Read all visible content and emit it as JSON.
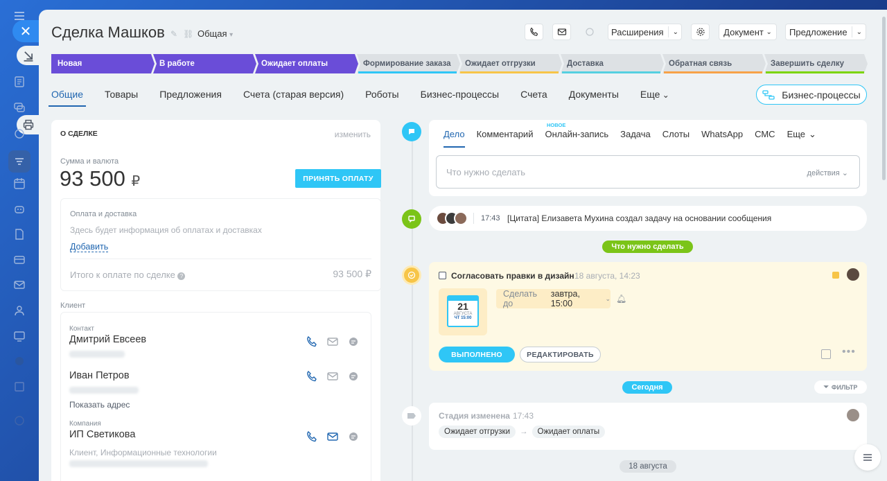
{
  "deal": {
    "title": "Сделка Машков",
    "category": "Общая",
    "category_arrow": "▾"
  },
  "toolbar": {
    "extensions": "Расширения",
    "document": "Документ",
    "proposal": "Предложение"
  },
  "stages": [
    {
      "label": "Новая",
      "bg": "#6a4dd8",
      "fg": "#ffffff"
    },
    {
      "label": "В работе",
      "bg": "#6a4dd8",
      "fg": "#ffffff"
    },
    {
      "label": "Ожидает оплаты",
      "bg": "#6a4dd8",
      "fg": "#ffffff"
    },
    {
      "label": "Формирование заказа",
      "bg": "#dde1e4",
      "fg": "#535c69",
      "accent": "#2fc6f6"
    },
    {
      "label": "Ожидает отгрузки",
      "bg": "#dde1e4",
      "fg": "#535c69",
      "accent": "#f7c548"
    },
    {
      "label": "Доставка",
      "bg": "#dde1e4",
      "fg": "#535c69",
      "accent": "#55d0e0"
    },
    {
      "label": "Обратная связь",
      "bg": "#dde1e4",
      "fg": "#535c69",
      "accent": "#f7a248"
    },
    {
      "label": "Завершить сделку",
      "bg": "#dde1e4",
      "fg": "#535c69",
      "accent": "#7bd500"
    }
  ],
  "tabs": [
    {
      "label": "Общие",
      "active": true
    },
    {
      "label": "Товары"
    },
    {
      "label": "Предложения"
    },
    {
      "label": "Счета (старая версия)"
    },
    {
      "label": "Роботы"
    },
    {
      "label": "Бизнес-процессы"
    },
    {
      "label": "Счета"
    },
    {
      "label": "Документы"
    },
    {
      "label": "Еще"
    }
  ],
  "bp_button": "Бизнес-процессы",
  "about": {
    "header": "О СДЕЛКЕ",
    "edit": "изменить",
    "sum_label": "Сумма и валюта",
    "sum_value": "93 500",
    "currency": "₽",
    "accept_payment": "ПРИНЯТЬ ОПЛАТУ",
    "payment_label": "Оплата и доставка",
    "payment_info": "Здесь будет информация об оплатах и доставках",
    "add": "Добавить",
    "total_label": "Итого к оплате по сделке",
    "total_value": "93 500 ₽",
    "client_label": "Клиент"
  },
  "contacts": [
    {
      "type": "Контакт",
      "name": "Дмитрий Евсеев",
      "extra": ""
    },
    {
      "type": "",
      "name": "Иван Петров",
      "extra": "Показать адрес"
    },
    {
      "type": "Компания",
      "name": "ИП Светикова",
      "extra": "Клиент, Информационные технологии"
    }
  ],
  "activity": {
    "tabs": [
      "Дело",
      "Комментарий",
      "Онлайн-запись",
      "Задача",
      "Слоты",
      "WhatsApp",
      "СМС",
      "Еще"
    ],
    "new_badge": "НОВОЕ",
    "placeholder": "Что нужно сделать",
    "actions": "действия"
  },
  "feed": {
    "quote_time": "17:43",
    "quote_text": "[Цитата] Елизавета Мухина создал задачу на основании сообщения",
    "todo_pill": "Что нужно сделать",
    "task_title": "Согласовать правки в дизайн",
    "task_date": "18 августа, 14:23",
    "cal_day": "21",
    "cal_month": "АВГУСТА",
    "cal_sub": "ЧТ 15:00",
    "deadline_prefix": "Сделать до",
    "deadline_value": "завтра, 15:00",
    "done_btn": "ВЫПОЛНЕНО",
    "edit_btn": "РЕДАКТИРОВАТЬ",
    "today_pill": "Сегодня",
    "filter": "ФИЛЬТР",
    "stage_changed": "Стадия изменена",
    "stage_time": "17:43",
    "stage_from": "Ожидает отгрузки",
    "stage_arrow": "→",
    "stage_to": "Ожидает оплаты",
    "date_pill": "18 августа"
  },
  "colors": {
    "accent": "#2fc6f6",
    "link": "#2066b0",
    "stage_done": "#6a4dd8",
    "task_bg": "#fef9e4",
    "green": "#7bc418"
  }
}
